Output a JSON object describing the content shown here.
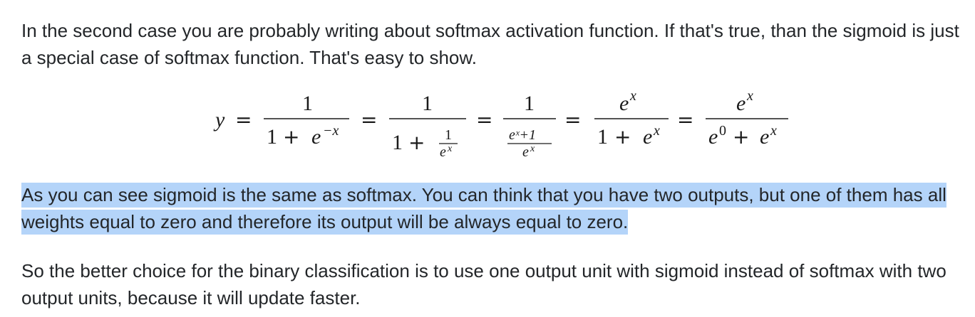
{
  "paragraphs": {
    "intro": "In the second case you are probably writing about softmax activation function. If that's true, than the sigmoid is just a special case of softmax function. That's easy to show.",
    "highlighted": "As you can see sigmoid is the same as softmax. You can think that you have two outputs, but one of them has all weights equal to zero and therefore its output will be always equal to zero.",
    "conclusion": "So the better choice for the binary classification is to use one output unit with sigmoid instead of softmax with two output units, because it will update faster."
  },
  "equation": {
    "lhs": "y",
    "equals": "=",
    "one": "1",
    "plus": "+",
    "e": "e",
    "neg_x": "−x",
    "x": "x",
    "zero": "0",
    "inner_numerator": "eˣ+1",
    "colors": {
      "highlight": "#b4d4f9",
      "text": "#232629"
    }
  }
}
